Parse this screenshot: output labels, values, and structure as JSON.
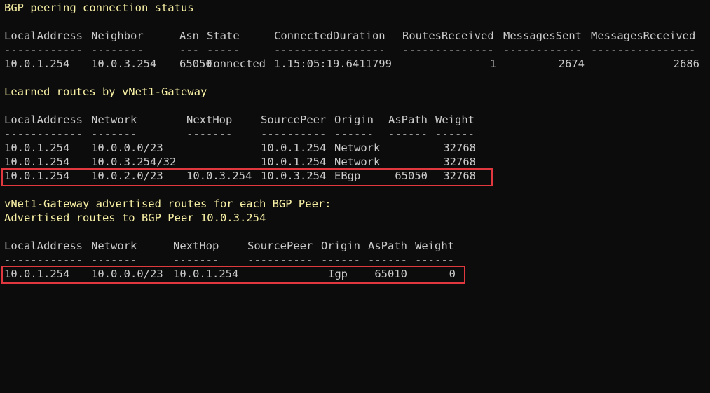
{
  "sections": {
    "bgp_status_title": "BGP peering connection status",
    "learned_routes_title": "Learned routes by vNet1-Gateway",
    "advertised_title_1": "vNet1-Gateway advertised routes for each BGP Peer:",
    "advertised_title_2": "Advertised routes to BGP Peer 10.0.3.254"
  },
  "peer_table": {
    "headers": [
      "LocalAddress",
      "Neighbor",
      "Asn",
      "State",
      "ConnectedDuration",
      "RoutesReceived",
      "MessagesSent",
      "MessagesReceived"
    ],
    "underlines": [
      "------------",
      "--------",
      "---",
      "-----",
      "-----------------",
      "--------------",
      "------------",
      "----------------"
    ],
    "rows": [
      [
        "10.0.1.254",
        "10.0.3.254",
        "65050",
        "Connected",
        "1.15:05:19.6411799",
        "1",
        "2674",
        "2686"
      ]
    ]
  },
  "learned_table": {
    "headers": [
      "LocalAddress",
      "Network",
      "NextHop",
      "SourcePeer",
      "Origin",
      "AsPath",
      "Weight"
    ],
    "underlines": [
      "------------",
      "-------",
      "-------",
      "----------",
      "------",
      "------",
      "------"
    ],
    "rows": [
      [
        "10.0.1.254",
        "10.0.0.0/23",
        "",
        "10.0.1.254",
        "Network",
        "",
        "32768"
      ],
      [
        "10.0.1.254",
        "10.0.3.254/32",
        "",
        "10.0.1.254",
        "Network",
        "",
        "32768"
      ],
      [
        "10.0.1.254",
        "10.0.2.0/23",
        "10.0.3.254",
        "10.0.3.254",
        "EBgp",
        "65050",
        "32768"
      ]
    ]
  },
  "advertised_table": {
    "headers": [
      "LocalAddress",
      "Network",
      "NextHop",
      "SourcePeer",
      "Origin",
      "AsPath",
      "Weight"
    ],
    "underlines": [
      "------------",
      "-------",
      "-------",
      "----------",
      "------",
      "------",
      "------"
    ],
    "rows": [
      [
        "10.0.1.254",
        "10.0.0.0/23",
        "10.0.1.254",
        "",
        "Igp",
        "65010",
        "0"
      ]
    ]
  },
  "colors": {
    "background": "#0c0c0c",
    "text": "#cccccc",
    "heading": "#f9f1a5",
    "highlight_border": "#e0383e"
  }
}
